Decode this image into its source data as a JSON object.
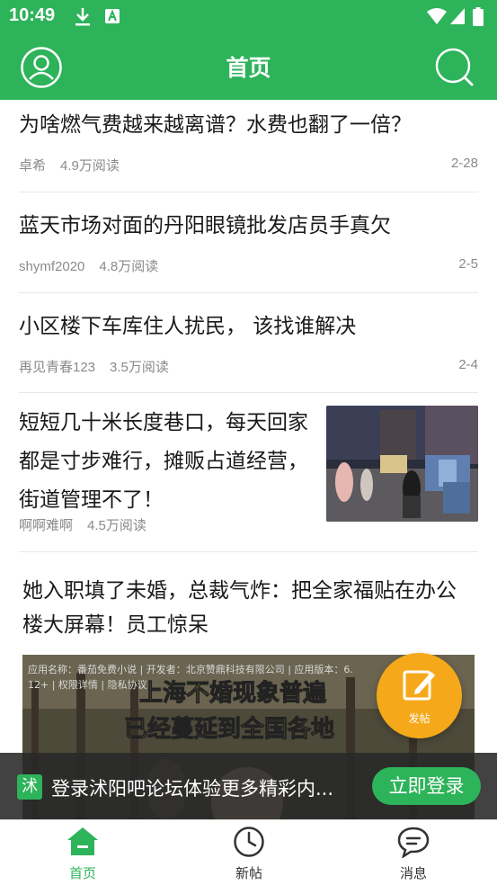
{
  "status_bar": {
    "time": "10:49",
    "left_icons": [
      "download-icon",
      "app-icon"
    ],
    "right_icons": [
      "wifi-icon",
      "signal-icon",
      "battery-icon"
    ]
  },
  "header": {
    "title": "首页",
    "left_icon": "user-icon",
    "right_icon": "search-icon"
  },
  "feed": [
    {
      "title": "为啥燃气费越来越离谱？水费也翻了一倍？",
      "author": "卓希",
      "reads": "4.9万阅读",
      "date": "2-28"
    },
    {
      "title": "蓝天市场对面的丹阳眼镜批发店员手真欠",
      "author": "shymf2020",
      "reads": "4.8万阅读",
      "date": "2-5"
    },
    {
      "title": "小区楼下车库住人扰民， 该找谁解决",
      "author": "再见青春123",
      "reads": "3.5万阅读",
      "date": "2-4"
    },
    {
      "title": "短短几十米长度巷口，每天回家都是寸步难行，摊贩占道经营，街道管理不了！",
      "author": "啊啊难啊",
      "reads": "4.5万阅读",
      "date": ""
    }
  ],
  "ad": {
    "title": "她入职填了未婚，总裁气炸：把全家福贴在办公楼大屏幕！员工惊呆",
    "info_line1": "应用名称：番茄免费小说 | 开发者：北京赞鼎科技有限公司 | 应用版本：6.",
    "info_line2": "12+ | 权限详情 | 隐私协议",
    "overlay_line1": "上海不婚现象普遍",
    "overlay_line2": "已经蔓延到全国各地"
  },
  "fab": {
    "label": "发帖",
    "icon": "edit-icon"
  },
  "login_bar": {
    "logo": "沭",
    "text": "登录沭阳吧论坛体验更多精彩内...",
    "button": "立即登录"
  },
  "tabbar": [
    {
      "label": "首页",
      "icon": "home-icon",
      "active": true
    },
    {
      "label": "新帖",
      "icon": "clock-icon",
      "active": false
    },
    {
      "label": "消息",
      "icon": "message-icon",
      "active": false
    }
  ],
  "colors": {
    "primary": "#2db35a",
    "fab": "#f5a91a",
    "meta": "#8a8a8a"
  }
}
